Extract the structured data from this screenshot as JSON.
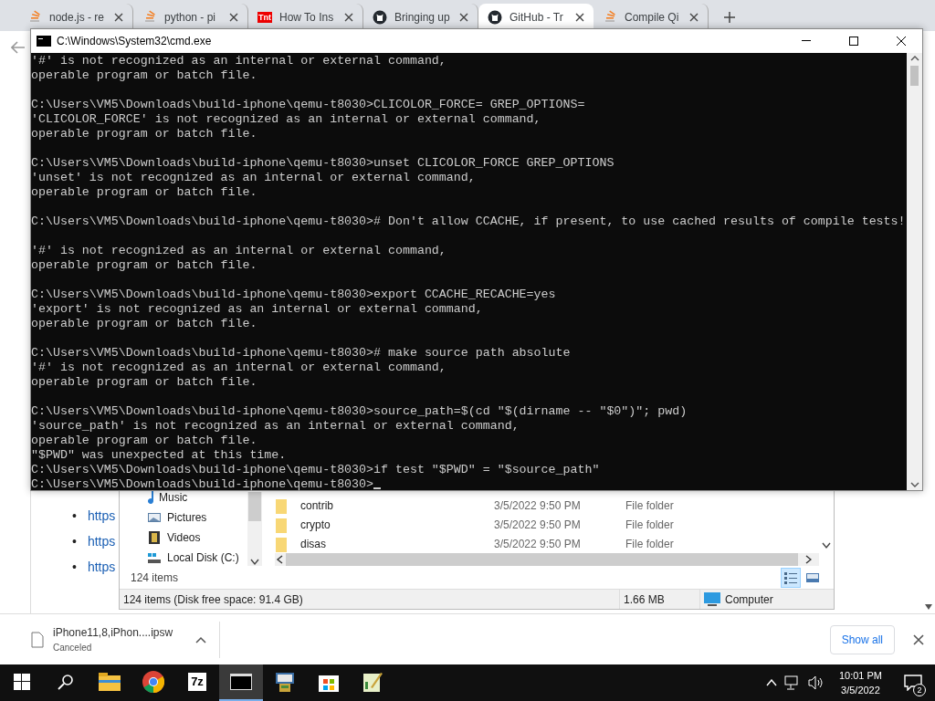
{
  "browser": {
    "tabs": [
      {
        "kind": "stack",
        "label": "node.js - re",
        "selected": false
      },
      {
        "kind": "stack",
        "label": "python - pi",
        "selected": false
      },
      {
        "kind": "badge",
        "badge": "Tnt",
        "label": "How To Ins",
        "selected": false
      },
      {
        "kind": "github",
        "label": "Bringing up",
        "selected": false
      },
      {
        "kind": "github",
        "label": "GitHub - Tr",
        "selected": true
      },
      {
        "kind": "stack",
        "label": "Compile Qi",
        "selected": false
      }
    ],
    "page": {
      "links": [
        {
          "bullet": "•",
          "text": "https"
        },
        {
          "bullet": "•",
          "text": "https"
        },
        {
          "bullet": "•",
          "text": "https"
        }
      ]
    }
  },
  "console": {
    "title": "C:\\Windows\\System32\\cmd.exe",
    "cursor": true,
    "blocks": [
      [
        "'#' is not recognized as an internal or external command,",
        "operable program or batch file."
      ],
      [
        "C:\\Users\\VM5\\Downloads\\build-iphone\\qemu-t8030>CLICOLOR_FORCE= GREP_OPTIONS=",
        "'CLICOLOR_FORCE' is not recognized as an internal or external command,",
        "operable program or batch file."
      ],
      [
        "C:\\Users\\VM5\\Downloads\\build-iphone\\qemu-t8030>unset CLICOLOR_FORCE GREP_OPTIONS",
        "'unset' is not recognized as an internal or external command,",
        "operable program or batch file."
      ],
      [
        "C:\\Users\\VM5\\Downloads\\build-iphone\\qemu-t8030># Don't allow CCACHE, if present, to use cached results of compile tests!"
      ],
      [
        "'#' is not recognized as an internal or external command,",
        "operable program or batch file."
      ],
      [
        "C:\\Users\\VM5\\Downloads\\build-iphone\\qemu-t8030>export CCACHE_RECACHE=yes",
        "'export' is not recognized as an internal or external command,",
        "operable program or batch file."
      ],
      [
        "C:\\Users\\VM5\\Downloads\\build-iphone\\qemu-t8030># make source path absolute",
        "'#' is not recognized as an internal or external command,",
        "operable program or batch file."
      ],
      [
        "C:\\Users\\VM5\\Downloads\\build-iphone\\qemu-t8030>source_path=$(cd \"$(dirname -- \"$0\")\"; pwd)",
        "'source_path' is not recognized as an internal or external command,",
        "operable program or batch file.",
        "\"$PWD\" was unexpected at this time.",
        "C:\\Users\\VM5\\Downloads\\build-iphone\\qemu-t8030>if test \"$PWD\" = \"$source_path\"",
        "C:\\Users\\VM5\\Downloads\\build-iphone\\qemu-t8030>"
      ]
    ]
  },
  "explorer": {
    "nav": [
      {
        "kind": "music",
        "label": "Music"
      },
      {
        "kind": "pictures",
        "label": "Pictures"
      },
      {
        "kind": "videos",
        "label": "Videos"
      },
      {
        "kind": "disk",
        "label": "Local Disk (C:)"
      }
    ],
    "files": [
      {
        "name": "contrib",
        "date": "3/5/2022 9:50 PM",
        "type": "File folder"
      },
      {
        "name": "crypto",
        "date": "3/5/2022 9:50 PM",
        "type": "File folder"
      },
      {
        "name": "disas",
        "date": "3/5/2022 9:50 PM",
        "type": "File folder"
      }
    ],
    "details": "124 items",
    "views": [
      {
        "kind": "details",
        "selected": true
      },
      {
        "kind": "tiles",
        "selected": false
      }
    ],
    "status": {
      "summary": "124 items (Disk free space: 91.4 GB)",
      "size": "1.66 MB",
      "location": "Computer"
    }
  },
  "downloads": {
    "file": "iPhone11,8,iPhon....ipsw",
    "state": "Canceled",
    "show_all": "Show all"
  },
  "taskbar": {
    "apps": [
      {
        "kind": "explorer",
        "selected": false
      },
      {
        "kind": "chrome",
        "selected": false
      },
      {
        "kind": "zip",
        "label": "7z",
        "selected": false
      },
      {
        "kind": "console",
        "selected": true
      },
      {
        "kind": "installer",
        "selected": false
      },
      {
        "kind": "store",
        "selected": false
      },
      {
        "kind": "editor",
        "selected": false
      }
    ],
    "time": "10:01 PM",
    "date": "3/5/2022",
    "notifications": "2"
  }
}
